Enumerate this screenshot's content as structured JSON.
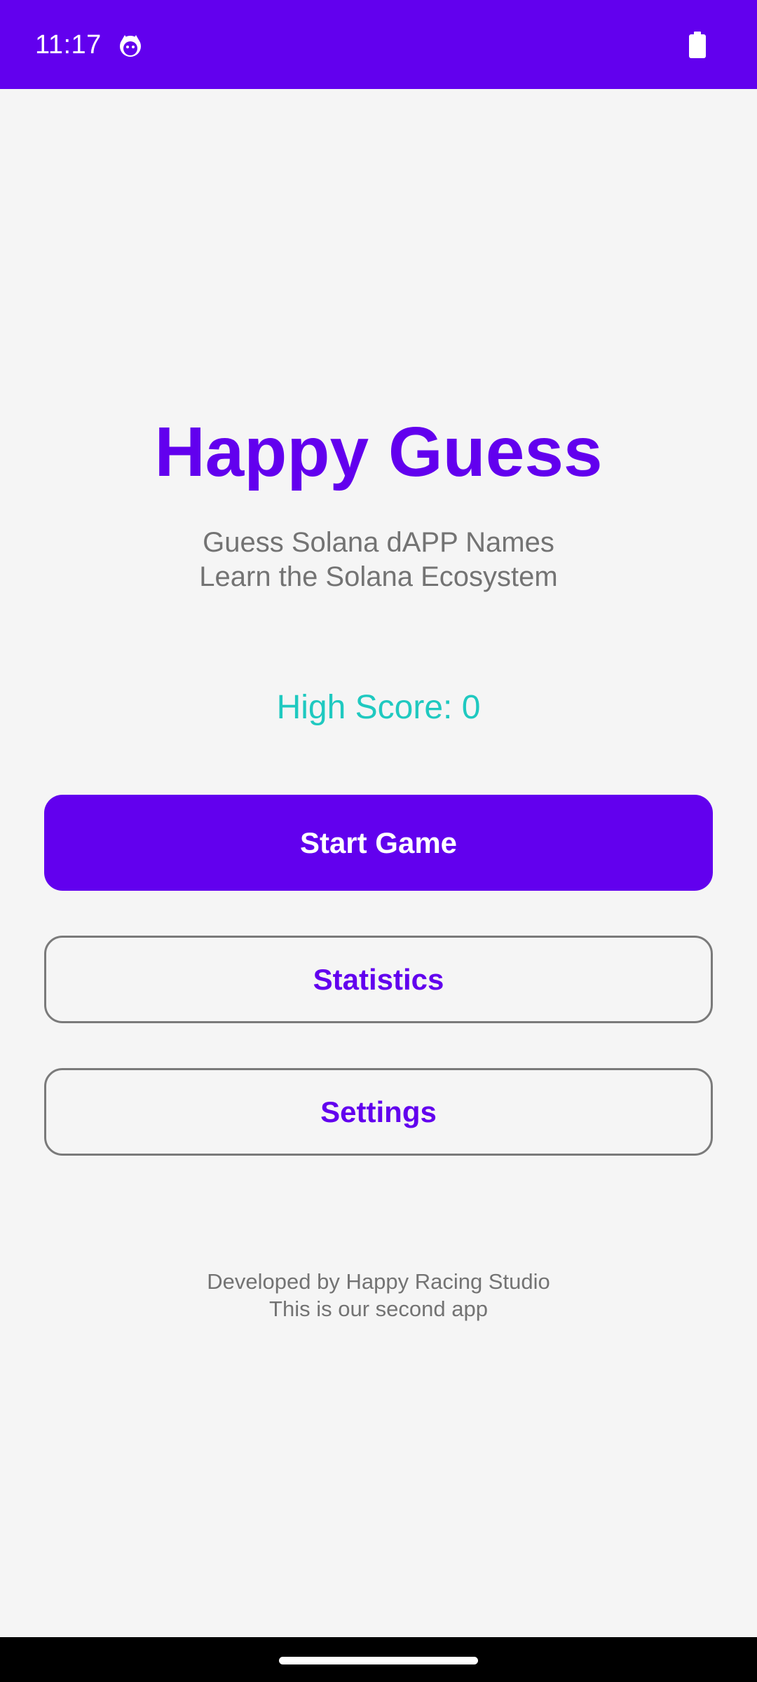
{
  "status_bar": {
    "time": "11:17",
    "app_icon": "cat-face-icon",
    "battery_icon": "battery-full-icon",
    "color": "#6200ee"
  },
  "main": {
    "title": "Happy Guess",
    "subtitle_line1": "Guess Solana dAPP Names",
    "subtitle_line2": "Learn the Solana Ecosystem",
    "high_score_label": "High Score: 0"
  },
  "buttons": {
    "start_label": "Start Game",
    "statistics_label": "Statistics",
    "settings_label": "Settings"
  },
  "footer": {
    "line1": "Developed by Happy Racing Studio",
    "line2": "This is our second app"
  },
  "colors": {
    "accent": "#6200ee",
    "score": "#1fc9c0",
    "muted_text": "#737373",
    "background": "#f5f5f5"
  }
}
